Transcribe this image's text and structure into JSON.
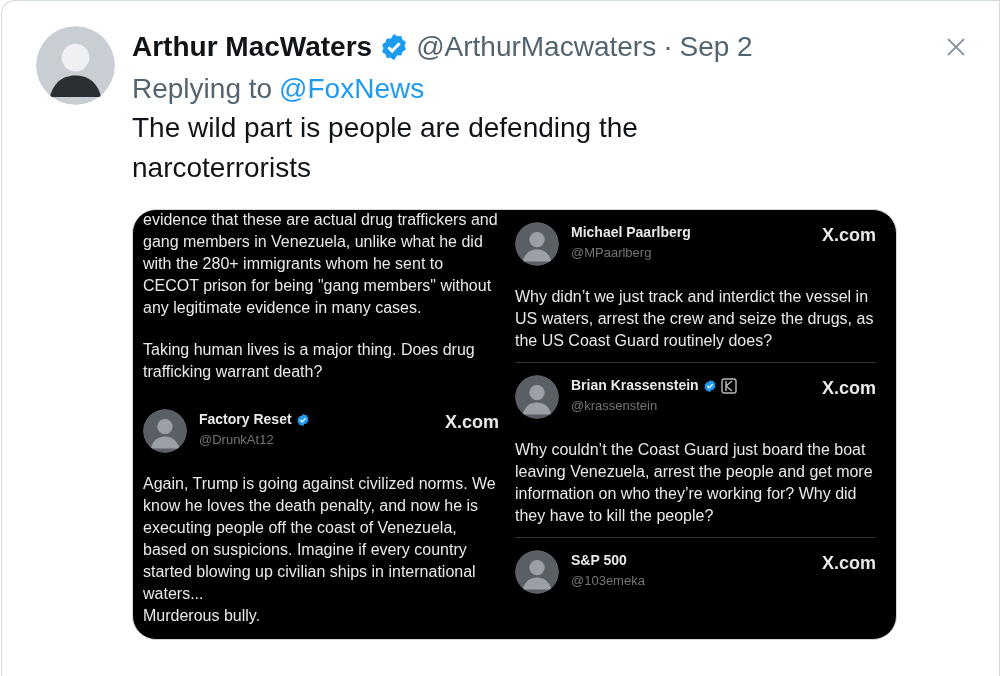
{
  "tweet": {
    "author": {
      "name": "Arthur MacWaters",
      "verified": true,
      "handle": "@ArthurMacwaters",
      "separator": "·",
      "date": "Sep 2"
    },
    "reply": {
      "prefix": "Replying to",
      "handle": "@FoxNews"
    },
    "text": "The wild part is people are defending the narcoterrorists",
    "media": {
      "left_column": [
        {
          "kind": "paragraph",
          "text": "evidence that these are actual drug traffickers and gang members in Venezuela, unlike what he did with the 280+ immigrants whom he sent to CECOT prison for being \"gang members\" without any legitimate evidence in many cases."
        },
        {
          "kind": "paragraph",
          "text": "Taking human lives is a major thing. Does drug trafficking warrant death?"
        },
        {
          "kind": "post",
          "name": "Factory Reset",
          "verified": true,
          "affiliate": false,
          "handle": "@DrunkAt12",
          "source": "X.com",
          "text": "Again, Trump is going against civilized norms. We know he loves the death penalty, and now he is executing people off the coast of Venezuela, based on suspicions. Imagine if every country started blowing up civilian ships in international waters...\nMurderous bully."
        }
      ],
      "right_column": [
        {
          "kind": "post",
          "name": "Michael Paarlberg",
          "verified": false,
          "affiliate": false,
          "handle": "@MPaarlberg",
          "source": "X.com",
          "text": "Why didn’t we just track and interdict the vessel in US waters, arrest the crew and seize the drugs, as the US Coast Guard routinely does?"
        },
        {
          "kind": "post",
          "name": "Brian Krassenstein",
          "verified": true,
          "affiliate": true,
          "handle": "@krassenstein",
          "source": "X.com",
          "text": "Why couldn’t the Coast Guard just board the boat leaving Venezuela, arrest the people and get more information on who they’re working for? Why did they have to kill the people?"
        },
        {
          "kind": "post",
          "name": "S&P 500",
          "verified": false,
          "affiliate": false,
          "handle": "@103emeka",
          "source": "X.com"
        }
      ]
    }
  }
}
